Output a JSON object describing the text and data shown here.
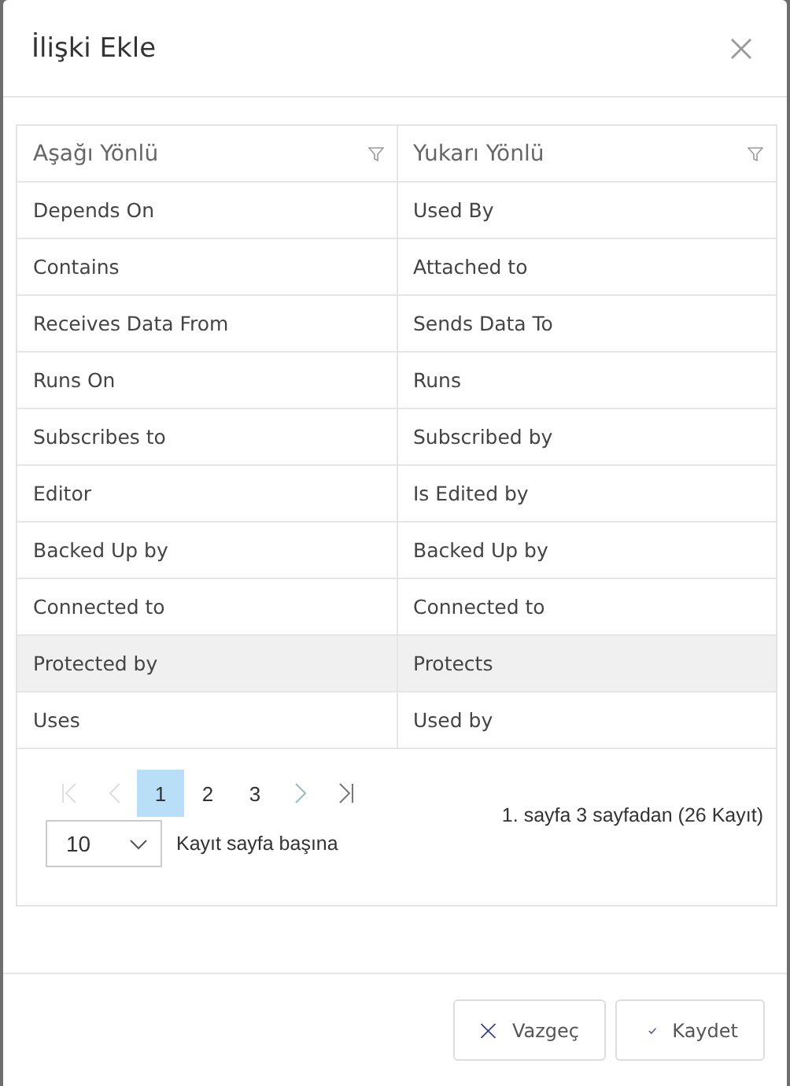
{
  "dialog": {
    "title": "İlişki Ekle"
  },
  "table": {
    "columns": [
      "Aşağı Yönlü",
      "Yukarı Yönlü"
    ],
    "rows": [
      {
        "cells": [
          "Depends On",
          "Used By"
        ],
        "selected": false
      },
      {
        "cells": [
          "Contains",
          "Attached to"
        ],
        "selected": false
      },
      {
        "cells": [
          "Receives Data From",
          "Sends Data To"
        ],
        "selected": false
      },
      {
        "cells": [
          "Runs On",
          "Runs"
        ],
        "selected": false
      },
      {
        "cells": [
          "Subscribes to",
          "Subscribed by"
        ],
        "selected": false
      },
      {
        "cells": [
          "Editor",
          "Is Edited by"
        ],
        "selected": false
      },
      {
        "cells": [
          "Backed Up by",
          "Backed Up by"
        ],
        "selected": false
      },
      {
        "cells": [
          "Connected to",
          "Connected to"
        ],
        "selected": false
      },
      {
        "cells": [
          "Protected by",
          "Protects"
        ],
        "selected": true
      },
      {
        "cells": [
          "Uses",
          "Used by"
        ],
        "selected": false
      }
    ]
  },
  "pager": {
    "first_disabled": true,
    "prev_disabled": true,
    "next_disabled": false,
    "last_disabled": false,
    "pages": [
      {
        "label": "1",
        "selected": true
      },
      {
        "label": "2",
        "selected": false
      },
      {
        "label": "3",
        "selected": false
      }
    ],
    "info": "1. sayfa 3 sayfadan (26 Kayıt)",
    "page_size": "10",
    "page_size_label": "Kayıt sayfa başına"
  },
  "buttons": [
    {
      "kind": "cancel",
      "label": "Vazgeç"
    },
    {
      "kind": "save",
      "label": "Kaydet"
    }
  ]
}
